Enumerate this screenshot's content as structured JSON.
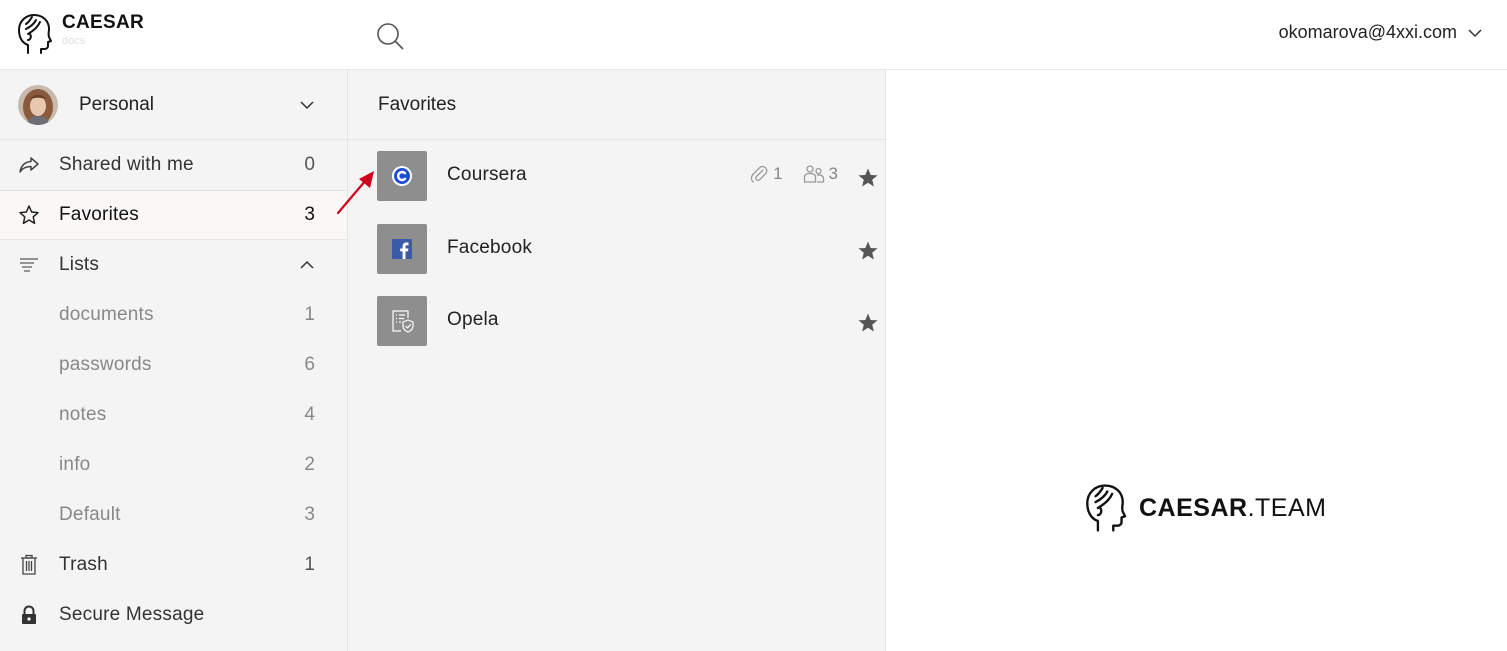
{
  "app": {
    "title": "CAESAR",
    "subtitle": "docs",
    "user_email": "okomarova@4xxi.com"
  },
  "sidebar": {
    "account": {
      "name": "Personal"
    },
    "items": [
      {
        "label": "Shared with me",
        "count": "0",
        "icon": "share-arrow-icon"
      },
      {
        "label": "Favorites",
        "count": "3",
        "icon": "star-outline-icon",
        "active": true
      },
      {
        "label": "Lists",
        "icon": "list-lines-icon",
        "expanded": true
      }
    ],
    "lists": [
      {
        "label": "documents",
        "count": "1"
      },
      {
        "label": "passwords",
        "count": "6"
      },
      {
        "label": "notes",
        "count": "4"
      },
      {
        "label": "info",
        "count": "2"
      },
      {
        "label": "Default",
        "count": "3"
      }
    ],
    "trash": {
      "label": "Trash",
      "count": "1",
      "icon": "trash-icon"
    },
    "secure": {
      "label": "Secure Message",
      "icon": "lock-icon"
    }
  },
  "list": {
    "title": "Favorites",
    "items": [
      {
        "name": "Coursera",
        "icon": "coursera-logo-icon",
        "attachments": "1",
        "shared": "3",
        "favorite": true
      },
      {
        "name": "Facebook",
        "icon": "facebook-logo-icon",
        "favorite": true
      },
      {
        "name": "Opela",
        "icon": "document-shield-icon",
        "favorite": true
      }
    ]
  },
  "detail": {
    "brand_strong": "CAESAR",
    "brand_light": ".TEAM"
  },
  "colors": {
    "sidebar_bg": "#f4f4f4",
    "item_icon_bg": "#8e8e8e",
    "annotation_arrow": "#d0021b"
  }
}
